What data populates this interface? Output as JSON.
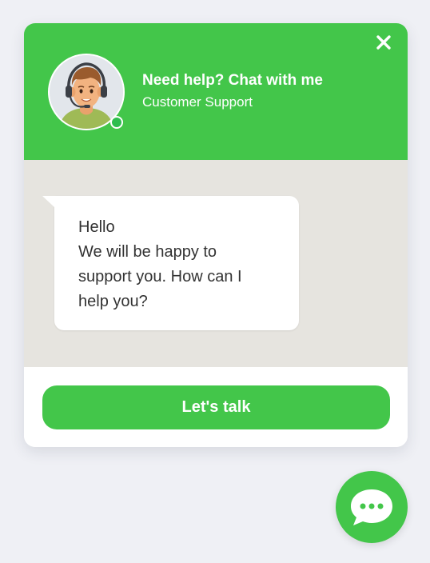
{
  "widget": {
    "header": {
      "title": "Need help? Chat with me",
      "subtitle": "Customer Support",
      "close_icon": "close-icon",
      "avatar_icon": "support-agent-avatar",
      "status": "online"
    },
    "message": {
      "lines": [
        "Hello",
        "We will be happy to",
        "support you. How can I",
        "help you?"
      ]
    },
    "footer": {
      "button_label": "Let's talk"
    },
    "launcher": {
      "icon": "chat-bubble-icon"
    }
  },
  "colors": {
    "brand_green": "#43c64a",
    "chat_background": "#e6e4df",
    "page_background": "#eff0f5",
    "online_dot": "#2dbd4e",
    "message_text": "#333333"
  }
}
